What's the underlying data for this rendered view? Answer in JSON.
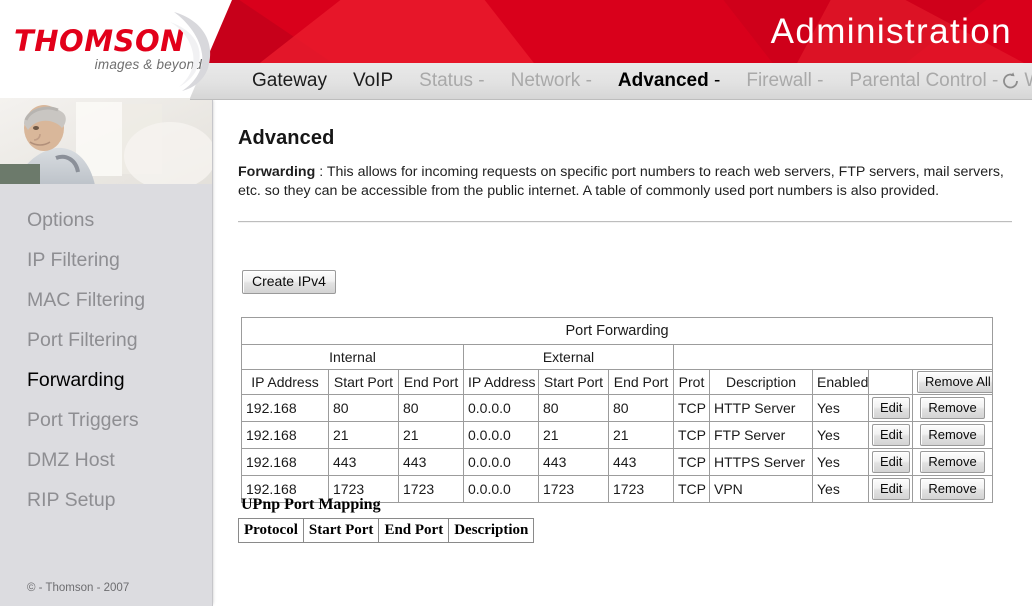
{
  "brand": {
    "logo_word": "THOMSON",
    "logo_tagline": "images & beyond",
    "banner_title": "Administration",
    "accent_color": "#d9001b",
    "logo_color": "#e2001a"
  },
  "nav": {
    "items": [
      {
        "label": "Gateway",
        "state": "dark",
        "caret": ""
      },
      {
        "label": "VoIP",
        "state": "dark",
        "caret": ""
      },
      {
        "label": "Status",
        "state": "muted",
        "caret": " -"
      },
      {
        "label": "Network",
        "state": "muted",
        "caret": " -"
      },
      {
        "label": "Advanced",
        "state": "active",
        "caret": " -"
      },
      {
        "label": "Firewall",
        "state": "muted",
        "caret": " -"
      },
      {
        "label": "Parental Control",
        "state": "muted",
        "caret": " -"
      },
      {
        "label": "Wireless",
        "state": "muted",
        "caret": ""
      }
    ],
    "refresh_icon": "refresh-icon"
  },
  "sidebar": {
    "photo_alt": "man-reading-photo",
    "items": [
      {
        "label": "Options",
        "active": false
      },
      {
        "label": "IP Filtering",
        "active": false
      },
      {
        "label": "MAC Filtering",
        "active": false
      },
      {
        "label": "Port Filtering",
        "active": false
      },
      {
        "label": "Forwarding",
        "active": true
      },
      {
        "label": "Port Triggers",
        "active": false
      },
      {
        "label": "DMZ Host",
        "active": false
      },
      {
        "label": "RIP Setup",
        "active": false
      }
    ],
    "footer": "© - Thomson - 2007"
  },
  "main": {
    "page_title": "Advanced",
    "intro_label": "Forwarding",
    "intro_sep": " :  ",
    "intro_text": "This allows for incoming requests on specific port numbers to reach web servers, FTP servers, mail servers, etc. so they can be accessible from the public internet. A table of commonly used port numbers is also provided.",
    "create_button": "Create IPv4"
  },
  "port_forwarding": {
    "title": "Port Forwarding",
    "group_internal": "Internal",
    "group_external": "External",
    "group_blank": "",
    "columns": [
      "IP Address",
      "Start Port",
      "End Port",
      "IP Address",
      "Start Port",
      "End Port",
      "Prot",
      "Description",
      "Enabled"
    ],
    "remove_all_label": "Remove All",
    "edit_label": "Edit",
    "remove_label": "Remove",
    "rows": [
      {
        "internal_ip": "192.168",
        "internal_start": "80",
        "internal_end": "80",
        "external_ip": "0.0.0.0",
        "external_start": "80",
        "external_end": "80",
        "prot": "TCP",
        "description": "HTTP Server",
        "enabled": "Yes"
      },
      {
        "internal_ip": "192.168",
        "internal_start": "21",
        "internal_end": "21",
        "external_ip": "0.0.0.0",
        "external_start": "21",
        "external_end": "21",
        "prot": "TCP",
        "description": "FTP Server",
        "enabled": "Yes"
      },
      {
        "internal_ip": "192.168",
        "internal_start": "443",
        "internal_end": "443",
        "external_ip": "0.0.0.0",
        "external_start": "443",
        "external_end": "443",
        "prot": "TCP",
        "description": "HTTPS Server",
        "enabled": "Yes"
      },
      {
        "internal_ip": "192.168",
        "internal_start": "1723",
        "internal_end": "1723",
        "external_ip": "0.0.0.0",
        "external_start": "1723",
        "external_end": "1723",
        "prot": "TCP",
        "description": "VPN",
        "enabled": "Yes"
      }
    ]
  },
  "upnp": {
    "title": "UPnp Port Mapping",
    "columns": [
      "Protocol",
      "Start Port",
      "End Port",
      "Description"
    ]
  }
}
